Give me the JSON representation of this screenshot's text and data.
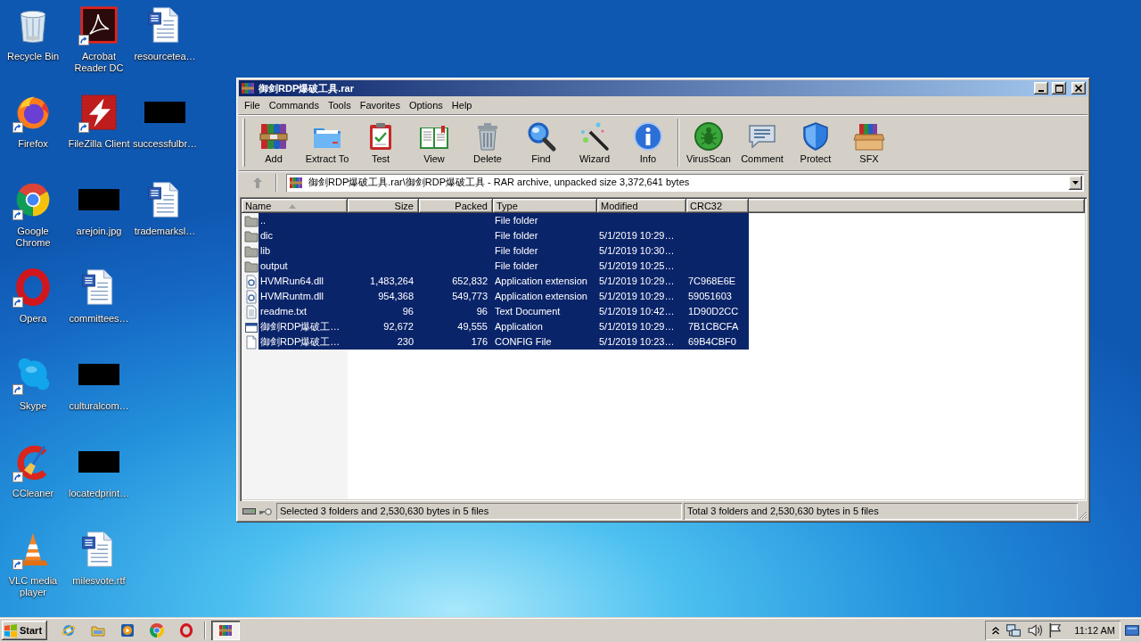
{
  "desktop": {
    "icons": [
      {
        "label": "Recycle Bin",
        "kind": "recycle-bin",
        "shortcut": false
      },
      {
        "label": "Firefox",
        "kind": "firefox",
        "shortcut": true
      },
      {
        "label": "Google Chrome",
        "kind": "chrome",
        "shortcut": true
      },
      {
        "label": "Opera",
        "kind": "opera",
        "shortcut": true
      },
      {
        "label": "Skype",
        "kind": "skype",
        "shortcut": true
      },
      {
        "label": "CCleaner",
        "kind": "ccleaner",
        "shortcut": true
      },
      {
        "label": "VLC media player",
        "kind": "vlc",
        "shortcut": true
      },
      {
        "label": "Acrobat Reader DC",
        "kind": "pdf",
        "shortcut": true
      },
      {
        "label": "FileZilla Client",
        "kind": "filezilla",
        "shortcut": true
      },
      {
        "label": "arejoin.jpg",
        "kind": "image",
        "shortcut": false
      },
      {
        "label": "committees…",
        "kind": "document",
        "shortcut": false
      },
      {
        "label": "culturalcom…",
        "kind": "image",
        "shortcut": false
      },
      {
        "label": "locatedprint…",
        "kind": "image",
        "shortcut": false
      },
      {
        "label": "milesvote.rtf",
        "kind": "document",
        "shortcut": false
      },
      {
        "label": "resourcetea…",
        "kind": "document",
        "shortcut": false
      },
      {
        "label": "successfulbr…",
        "kind": "image",
        "shortcut": false
      },
      {
        "label": "trademarksl…",
        "kind": "document",
        "shortcut": false
      }
    ]
  },
  "window": {
    "title": "御剑RDP爆破工具.rar",
    "menu": [
      "File",
      "Commands",
      "Tools",
      "Favorites",
      "Options",
      "Help"
    ],
    "toolbar": [
      [
        {
          "label": "Add",
          "kind": "add"
        },
        {
          "label": "Extract To",
          "kind": "extract"
        },
        {
          "label": "Test",
          "kind": "test"
        },
        {
          "label": "View",
          "kind": "view"
        },
        {
          "label": "Delete",
          "kind": "delete"
        },
        {
          "label": "Find",
          "kind": "find"
        },
        {
          "label": "Wizard",
          "kind": "wizard"
        },
        {
          "label": "Info",
          "kind": "info"
        }
      ],
      [
        {
          "label": "VirusScan",
          "kind": "virusscan"
        },
        {
          "label": "Comment",
          "kind": "comment"
        },
        {
          "label": "Protect",
          "kind": "protect"
        },
        {
          "label": "SFX",
          "kind": "sfx"
        }
      ]
    ],
    "address_bar": {
      "path": "御剑RDP爆破工具.rar\\御剑RDP爆破工具 - RAR archive, unpacked size 3,372,641 bytes"
    },
    "file_list": {
      "columns": [
        {
          "label": "Name",
          "sorted": true
        },
        {
          "label": "Size",
          "sorted": false
        },
        {
          "label": "Packed",
          "sorted": false
        },
        {
          "label": "Type",
          "sorted": false
        },
        {
          "label": "Modified",
          "sorted": false
        },
        {
          "label": "CRC32",
          "sorted": false
        }
      ],
      "rows": [
        {
          "kind": "folder",
          "name": "..",
          "type": "File folder",
          "selected": true
        },
        {
          "kind": "folder",
          "name": "dic",
          "type": "File folder",
          "modified": "5/1/2019 10:29…",
          "selected": true
        },
        {
          "kind": "folder",
          "name": "lib",
          "type": "File folder",
          "modified": "5/1/2019 10:30…",
          "selected": true
        },
        {
          "kind": "folder",
          "name": "output",
          "type": "File folder",
          "modified": "5/1/2019 10:25…",
          "selected": true
        },
        {
          "kind": "dll",
          "name": "HVMRun64.dll",
          "size": "1,483,264",
          "packed": "652,832",
          "type": "Application extension",
          "modified": "5/1/2019 10:29…",
          "crc32": "7C968E6E",
          "selected": true
        },
        {
          "kind": "dll",
          "name": "HVMRuntm.dll",
          "size": "954,368",
          "packed": "549,773",
          "type": "Application extension",
          "modified": "5/1/2019 10:29…",
          "crc32": "59051603",
          "selected": true
        },
        {
          "kind": "text",
          "name": "readme.txt",
          "size": "96",
          "packed": "96",
          "type": "Text Document",
          "modified": "5/1/2019 10:42…",
          "crc32": "1D90D2CC",
          "selected": true
        },
        {
          "kind": "app",
          "name": "御剑RDP爆破工…",
          "size": "92,672",
          "packed": "49,555",
          "type": "Application",
          "modified": "5/1/2019 10:29…",
          "crc32": "7B1CBCFA",
          "selected": true
        },
        {
          "kind": "config",
          "name": "御剑RDP爆破工…",
          "size": "230",
          "packed": "176",
          "type": "CONFIG File",
          "modified": "5/1/2019 10:23…",
          "crc32": "69B4CBF0",
          "selected": true
        }
      ]
    },
    "status_bar": {
      "selection": "Selected 3 folders and 2,530,630 bytes in 5 files",
      "total": "Total 3 folders and 2,530,630 bytes in 5 files"
    }
  },
  "taskbar": {
    "start": "Start",
    "quick_launch": [
      {
        "kind": "ie"
      },
      {
        "kind": "explorer"
      },
      {
        "kind": "media"
      },
      {
        "kind": "chrome"
      },
      {
        "kind": "opera"
      }
    ],
    "tasks": [
      {
        "kind": "winrar",
        "active": true
      }
    ],
    "clock": "11:12 AM"
  }
}
